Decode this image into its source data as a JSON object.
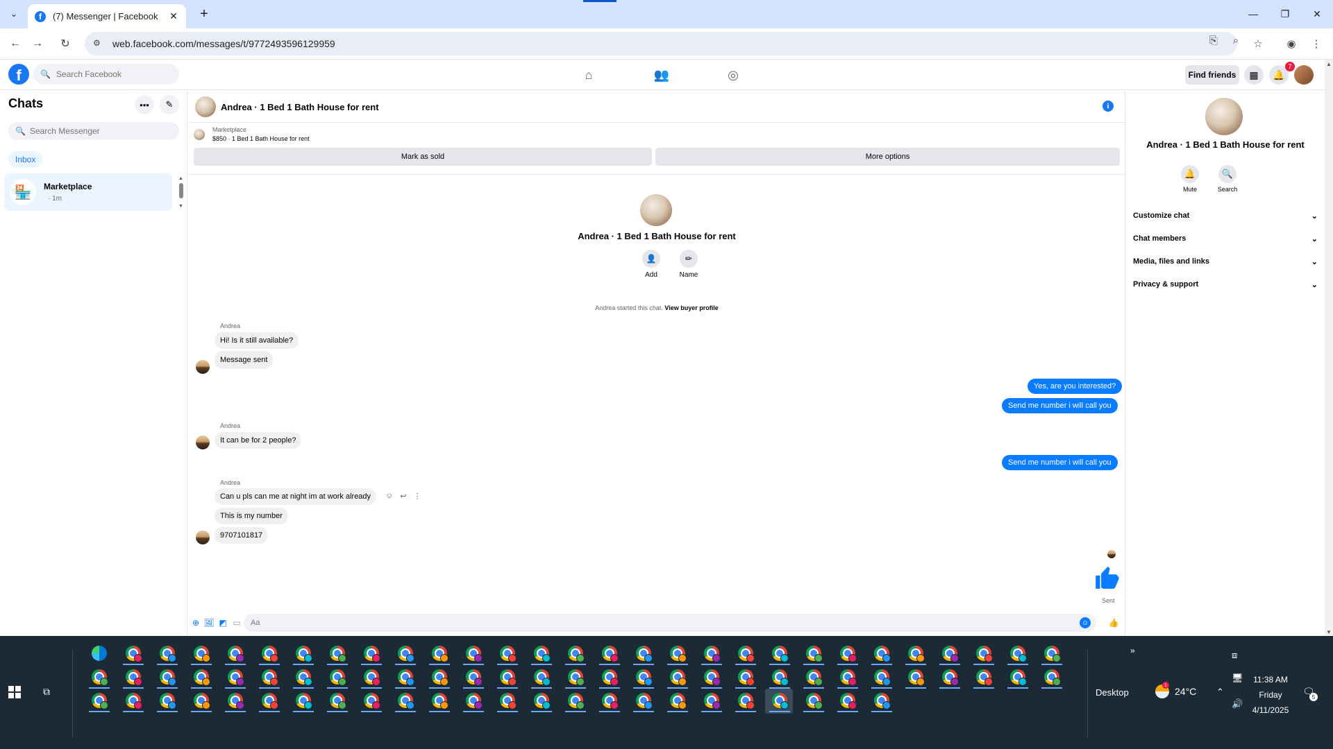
{
  "browser": {
    "tab_title": "(7) Messenger | Facebook",
    "url": "web.facebook.com/messages/t/9772493596129959"
  },
  "fb_header": {
    "search_placeholder": "Search Facebook",
    "find_friends": "Find friends",
    "notification_count": "7"
  },
  "chats": {
    "title": "Chats",
    "search_placeholder": "Search Messenger",
    "inbox_label": "Inbox",
    "items": [
      {
        "name": "Marketplace",
        "time": "· 1m"
      }
    ]
  },
  "conversation": {
    "title": "Andrea · 1 Bed 1 Bath House for rent",
    "marketplace_label": "Marketplace",
    "listing": "$850 · 1 Bed 1 Bath House for rent",
    "mark_as_sold": "Mark as sold",
    "more_options": "More options",
    "intro_title": "Andrea · 1 Bed 1 Bath House for rent",
    "add_label": "Add",
    "name_label": "Name",
    "started_text": "Andrea started this chat.",
    "view_buyer_profile": "View buyer profile",
    "sender_name": "Andrea",
    "messages": {
      "in_1": "Hi! Is it still available?",
      "in_2": "Message sent",
      "out_1": "Yes, are you interested?",
      "out_2": "Send me number i will call you",
      "in_3": "It can be for 2 people?",
      "out_3": "Send me number i will call you",
      "in_4": "Can u pls can me at night im at work already",
      "in_5": "This is my number",
      "in_6": "9707101817"
    },
    "sent_label": "Sent",
    "composer_placeholder": "Aa"
  },
  "details": {
    "title": "Andrea · 1 Bed 1 Bath House for rent",
    "mute": "Mute",
    "search": "Search",
    "sections": [
      "Customize chat",
      "Chat members",
      "Media, files and links",
      "Privacy & support"
    ]
  },
  "taskbar": {
    "desktop_label": "Desktop",
    "temperature": "24°C",
    "weather_badge": "1",
    "time": "11:38 AM",
    "day": "Friday",
    "date": "4/11/2025",
    "notification_count": "5"
  },
  "colors": {
    "fb_blue": "#1877f2",
    "messenger_blue": "#0a7cff",
    "taskbar_bg": "#1c2a36"
  }
}
